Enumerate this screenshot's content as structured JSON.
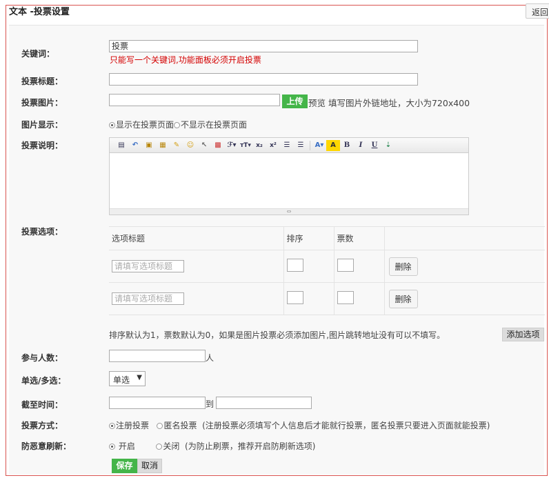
{
  "header": {
    "title": "文本 -投票设置",
    "back_label": "返回"
  },
  "form": {
    "keyword": {
      "label": "关键词：",
      "value": "投票",
      "hint": "只能写一个关键词,功能面板必须开启投票"
    },
    "vote_title": {
      "label": "投票标题：",
      "value": ""
    },
    "vote_image": {
      "label": "投票图片：",
      "value": "",
      "upload_label": "上传",
      "hint": "预览 填写图片外链地址，大小为720x400"
    },
    "image_display": {
      "label": "图片显示：",
      "option_show": "显示在投票页面",
      "option_hide": "不显示在投票页面",
      "selected": "show"
    },
    "vote_desc": {
      "label": "投票说明："
    },
    "vote_options": {
      "label": "投票选项：",
      "headers": [
        "选项标题",
        "排序",
        "票数",
        ""
      ],
      "rows": [
        {
          "placeholder": "请填写选项标题",
          "delete_label": "删除"
        },
        {
          "placeholder": "请填写选项标题",
          "delete_label": "删除"
        }
      ],
      "note": "排序默认为1，票数默认为0，如果是图片投票必须添加图片,图片跳转地址没有可以不填写。",
      "add_label": "添加选项"
    },
    "participants": {
      "label": "参与人数：",
      "unit": "人"
    },
    "choice_mode": {
      "label": "单选/多选：",
      "selected": "单选",
      "arrow": "▼"
    },
    "deadline": {
      "label": "截至时间：",
      "separator": "到"
    },
    "vote_mode": {
      "label": "投票方式：",
      "option_registered": "注册投票",
      "option_anonymous": "匿名投票",
      "note": "(注册投票必须填写个人信息后才能就行投票，匿名投票只要进入页面就能投票)"
    },
    "anti_refresh": {
      "label": "防恶意刷新：",
      "option_on": "开启",
      "option_off": "关闭",
      "note": "(为防止刷票，推荐开启防刷新选项)"
    }
  },
  "actions": {
    "save_label": "保存",
    "cancel_label": "取消"
  },
  "toolbar_icons": [
    "source-icon",
    "undo-icon",
    "paste-icon",
    "paste-text-icon",
    "format-brush-icon",
    "emoticon-icon",
    "select-icon",
    "preview-icon",
    "font-family-icon",
    "font-size-icon",
    "subscript-icon",
    "superscript-icon",
    "indent-icon",
    "outdent-icon",
    "font-color-icon",
    "highlight-icon",
    "bold-icon",
    "italic-icon",
    "underline-icon",
    "insert-icon"
  ],
  "colors": {
    "accent_green": "#44b549",
    "hint_red": "#d40000",
    "frame_red": "#d9534f"
  }
}
